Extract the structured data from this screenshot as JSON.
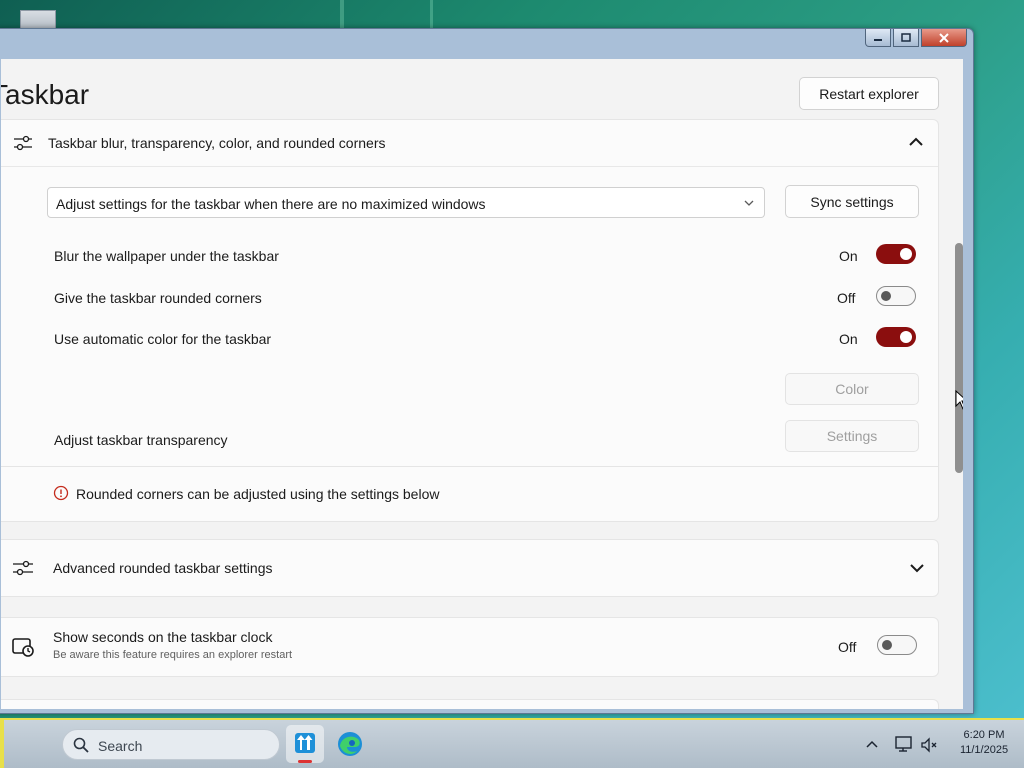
{
  "window": {
    "page_title": "Taskbar",
    "restart_button": "Restart explorer",
    "titlebar": {
      "minimize_icon": "minimize-icon",
      "maximize_icon": "maximize-icon",
      "close_icon": "close-icon"
    }
  },
  "blur_section": {
    "title": "Taskbar blur, transparency, color, and rounded corners",
    "icon": "sliders-icon",
    "expanded": true,
    "mode_select": {
      "value": "Adjust settings for the taskbar when there are no maximized windows"
    },
    "sync_button": "Sync settings",
    "rows": [
      {
        "label": "Blur the wallpaper under the taskbar",
        "state": "On",
        "checked": true
      },
      {
        "label": "Give the taskbar rounded corners",
        "state": "Off",
        "checked": false
      },
      {
        "label": "Use automatic color for the taskbar",
        "state": "On",
        "checked": true
      }
    ],
    "color_button": "Color",
    "transparency_label": "Adjust taskbar transparency",
    "settings_button": "Settings",
    "info_text": "Rounded corners can be adjusted using the settings below"
  },
  "advanced_section": {
    "title": "Advanced rounded taskbar settings",
    "icon": "sliders-icon",
    "expanded": false
  },
  "seconds_section": {
    "title": "Show seconds on the taskbar clock",
    "subtitle": "Be aware this feature requires an explorer restart",
    "state": "Off",
    "checked": false,
    "icon": "clock-icon"
  },
  "taskbar": {
    "search_placeholder": "Search",
    "time": "6:20 PM",
    "date": "11/1/2025",
    "apps": [
      "taskbar-tweaker-icon",
      "edge-icon"
    ]
  },
  "colors": {
    "accent": "#8b0e0e",
    "card": "#fbfbfb",
    "page": "#f3f3f3"
  }
}
